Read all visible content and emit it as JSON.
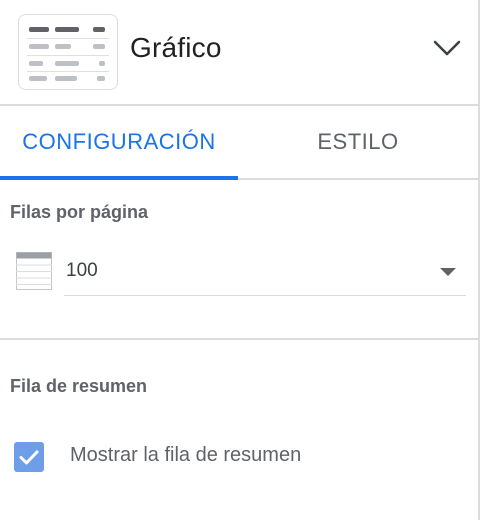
{
  "header": {
    "title": "Gráfico",
    "thumbnail_icon": "table-chart-icon",
    "expand_icon": "chevron-down-icon"
  },
  "tabs": [
    {
      "label": "CONFIGURACIÓN",
      "active": true
    },
    {
      "label": "ESTILO",
      "active": false
    }
  ],
  "rows_per_page": {
    "title": "Filas por página",
    "icon": "table-rows-icon",
    "value": "100"
  },
  "summary_row": {
    "title": "Fila de resumen",
    "checkbox_label": "Mostrar la fila de resumen",
    "checked": true
  },
  "colors": {
    "accent": "#1a73e8",
    "checkbox": "#6e9ee8",
    "divider": "#dadce0",
    "muted_text": "#5f6368"
  }
}
